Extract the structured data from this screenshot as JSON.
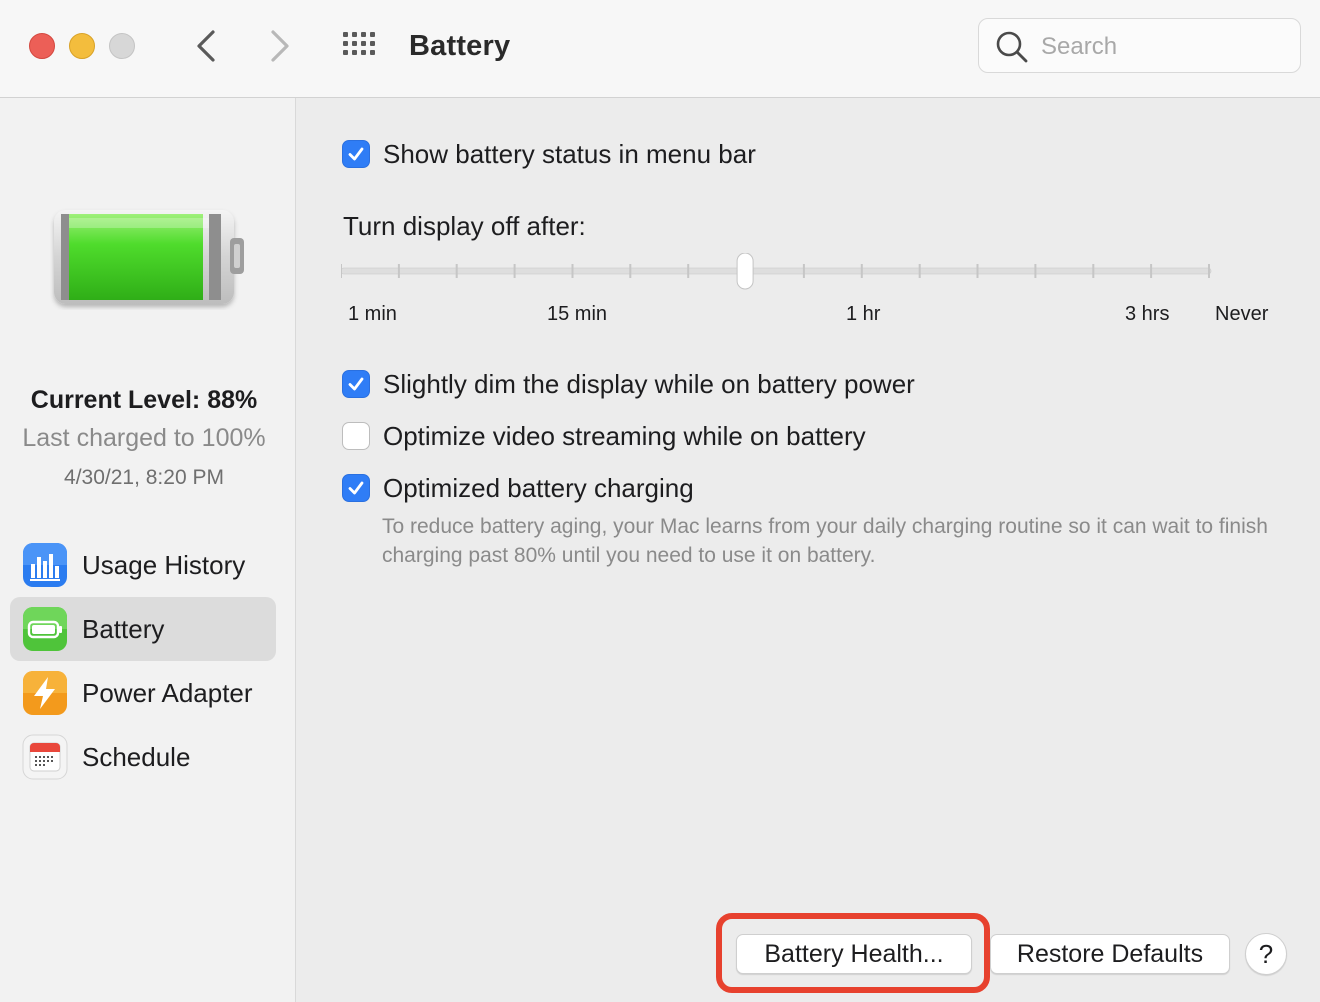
{
  "window": {
    "title": "Battery"
  },
  "toolbar": {
    "back_icon": "chevron-left-icon",
    "forward_icon": "chevron-right-icon",
    "grid_icon": "grid-icon",
    "search": {
      "placeholder": "Search",
      "value": ""
    }
  },
  "sidebar": {
    "status": {
      "current_level": "Current Level: 88%",
      "last_charged": "Last charged to 100%",
      "date": "4/30/21, 8:20 PM",
      "battery_level_fraction": 0.88
    },
    "items": [
      {
        "label": "Usage History",
        "icon": "bar-chart-icon",
        "selected": false
      },
      {
        "label": "Battery",
        "icon": "battery-icon",
        "selected": true
      },
      {
        "label": "Power Adapter",
        "icon": "lightning-icon",
        "selected": false
      },
      {
        "label": "Schedule",
        "icon": "calendar-icon",
        "selected": false
      }
    ]
  },
  "main": {
    "show_status": {
      "label": "Show battery status in menu bar",
      "checked": true
    },
    "display_off": {
      "label": "Turn display off after:",
      "tick_labels": [
        "1 min",
        "15 min",
        "1 hr",
        "3 hrs",
        "Never"
      ],
      "tick_count": 16,
      "value_index": 7
    },
    "dim_display": {
      "label": "Slightly dim the display while on battery power",
      "checked": true
    },
    "optimize_video": {
      "label": "Optimize video streaming while on battery",
      "checked": false
    },
    "optimized_charging": {
      "label": "Optimized battery charging",
      "checked": true,
      "description": "To reduce battery aging, your Mac learns from your daily charging routine so it can wait to finish charging past 80% until you need to use it on battery."
    },
    "buttons": {
      "battery_health": "Battery Health...",
      "restore_defaults": "Restore Defaults",
      "help": "?"
    }
  },
  "colors": {
    "accent": "#2f7df6",
    "highlight_ring": "#e7412e",
    "battery_green": "#3fcf2a"
  }
}
